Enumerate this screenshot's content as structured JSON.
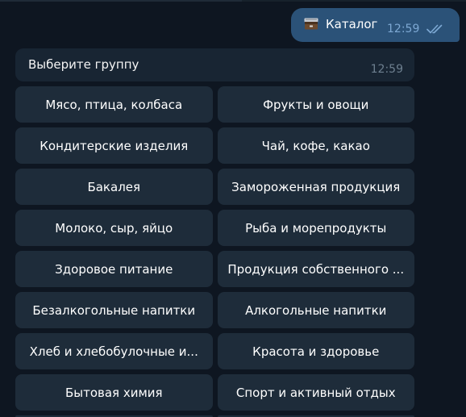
{
  "colors": {
    "background": "#0e1621",
    "outgoing_bubble": "#2b5278",
    "incoming_bubble": "#182533",
    "keyboard_button": "#1e2c3a",
    "read_check": "#7da8d3"
  },
  "outgoing_message": {
    "icon": "card-file-box-icon",
    "text": "Каталог",
    "time": "12:59",
    "status_icon": "double-check-read-icon"
  },
  "incoming_message": {
    "text": "Выберите группу",
    "time": "12:59"
  },
  "keyboard": {
    "rows": [
      [
        "Мясо, птица, колбаса",
        "Фрукты и овощи"
      ],
      [
        "Кондитерские изделия",
        "Чай, кофе, какао"
      ],
      [
        "Бакалея",
        "Замороженная продукция"
      ],
      [
        "Молоко, сыр, яйцо",
        "Рыба и морепродукты"
      ],
      [
        "Здоровое питание",
        "Продукция собственного ..."
      ],
      [
        "Безалкогольные напитки",
        "Алкогольные напитки"
      ],
      [
        "Хлеб и хлебобулочные и...",
        "Красота и здоровье"
      ],
      [
        "Бытовая химия",
        "Спорт и активный отдых"
      ]
    ]
  }
}
